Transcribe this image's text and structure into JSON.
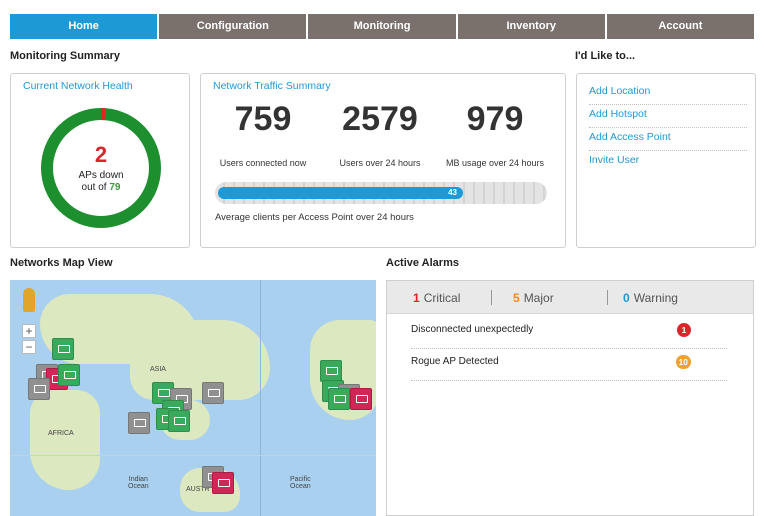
{
  "nav": {
    "tabs": [
      {
        "label": "Home",
        "active": true
      },
      {
        "label": "Configuration",
        "active": false
      },
      {
        "label": "Monitoring",
        "active": false
      },
      {
        "label": "Inventory",
        "active": false
      },
      {
        "label": "Account",
        "active": false
      }
    ]
  },
  "monitoring_summary": {
    "title": "Monitoring Summary",
    "health": {
      "title": "Current Network Health",
      "aps_down": "2",
      "aps_down_label": "APs down",
      "out_of_label": "out of",
      "total_aps": "79",
      "down_fraction": 0.0253
    },
    "traffic": {
      "title": "Network Traffic Summary",
      "stats": [
        {
          "value": "759",
          "label": "Users connected now"
        },
        {
          "value": "2579",
          "label": "Users over 24 hours"
        },
        {
          "value": "979",
          "label": "MB usage over 24 hours"
        }
      ],
      "avg_clients_value": "43",
      "avg_clients_fraction": 0.75,
      "avg_clients_label": "Average clients per Access Point over 24 hours"
    }
  },
  "id_like_to": {
    "title": "I'd Like to...",
    "links": [
      "Add Location",
      "Add Hotspot",
      "Add Access Point",
      "Invite User"
    ]
  },
  "map": {
    "title": "Networks Map View",
    "labels": [
      "ASIA",
      "AFRICA",
      "Indian\nOcean",
      "AUSTR",
      "Pacific\nOcean"
    ],
    "zoom_in": "+",
    "zoom_out": "−"
  },
  "alarms": {
    "title": "Active Alarms",
    "tabs": [
      {
        "count": "1",
        "label": "Critical",
        "color": "#d9262b"
      },
      {
        "count": "5",
        "label": "Major",
        "color": "#f08a1c"
      },
      {
        "count": "0",
        "label": "Warning",
        "color": "#1d9ad6"
      }
    ],
    "rows": [
      {
        "text": "Disconnected unexpectedly",
        "count": "1",
        "color": "#d9262b"
      },
      {
        "text": "Rogue AP Detected",
        "count": "10",
        "color": "#f0a030"
      }
    ]
  },
  "colors": {
    "accent": "#1d9ad6",
    "nav_bg": "#7a716c",
    "health_ok": "#1e8f2f",
    "health_down": "#e0261f"
  }
}
